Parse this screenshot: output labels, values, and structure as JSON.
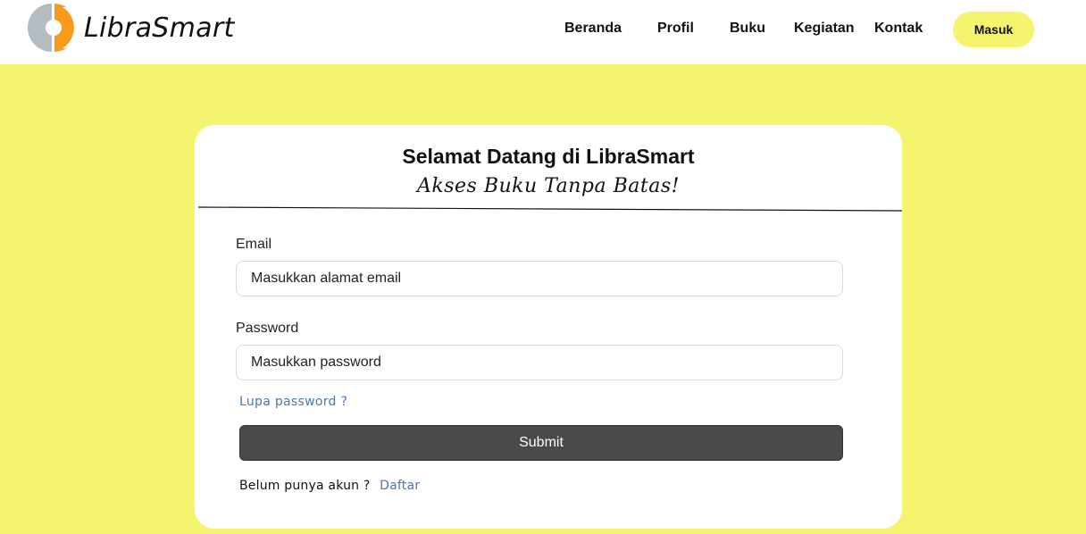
{
  "brand": {
    "name": "LibraSmart",
    "logo_icon": "librasmart-logo-icon",
    "accent": "#F5F46F",
    "logo_orange": "#F89A1C",
    "logo_gray": "#B4BCC2"
  },
  "nav": {
    "items": [
      {
        "label": "Beranda"
      },
      {
        "label": "Profil"
      },
      {
        "label": "Buku"
      },
      {
        "label": "Kegiatan"
      },
      {
        "label": "Kontak"
      }
    ],
    "login_label": "Masuk"
  },
  "card": {
    "title": "Selamat Datang di LibraSmart",
    "subtitle": "Akses Buku Tanpa Batas!",
    "email": {
      "label": "Email",
      "placeholder": "Masukkan alamat email",
      "value": ""
    },
    "password": {
      "label": "Password",
      "placeholder": "Masukkan password",
      "value": ""
    },
    "forgot_label": "Lupa password ?",
    "submit_label": "Submit",
    "register_prompt": "Belum punya akun ?",
    "register_label": "Daftar"
  },
  "colors": {
    "page_bg": "#F5F46F",
    "link": "#4D79A8",
    "submit_bg": "#4A4A4A"
  }
}
